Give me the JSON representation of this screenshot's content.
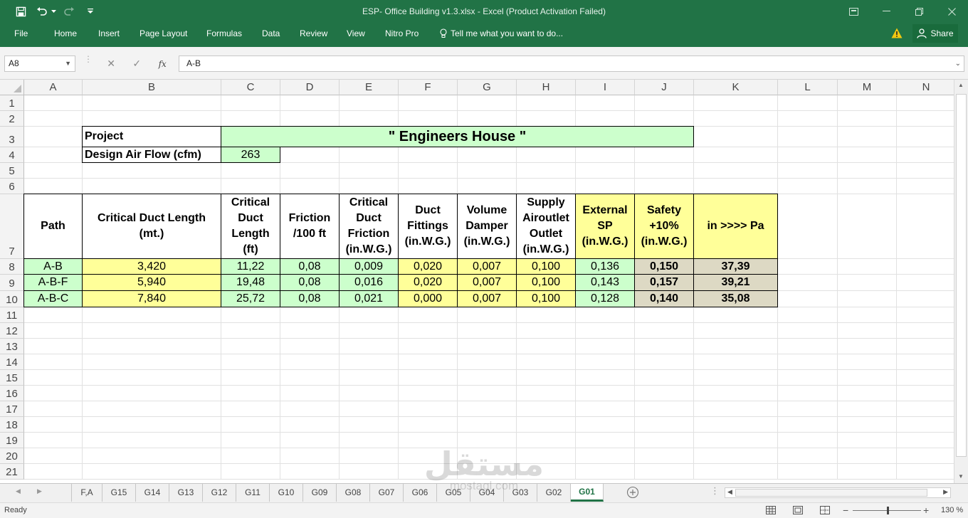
{
  "window": {
    "title": "ESP- Office Building v1.3.xlsx - Excel (Product Activation Failed)"
  },
  "ribbon": {
    "tabs": [
      "File",
      "Home",
      "Insert",
      "Page Layout",
      "Formulas",
      "Data",
      "Review",
      "View",
      "Nitro Pro"
    ],
    "tell_me": "Tell me what you want to do...",
    "share": "Share"
  },
  "formula_bar": {
    "name_box": "A8",
    "content": "A-B"
  },
  "columns": [
    "A",
    "B",
    "C",
    "D",
    "E",
    "F",
    "G",
    "H",
    "I",
    "J",
    "K",
    "L",
    "M",
    "N"
  ],
  "rows": [
    "1",
    "2",
    "3",
    "4",
    "5",
    "6",
    "7",
    "8",
    "9",
    "10",
    "11",
    "12",
    "13",
    "14",
    "15",
    "16",
    "17",
    "18",
    "19",
    "20",
    "21"
  ],
  "sheet": {
    "project_label": "Project",
    "project_name": "\" Engineers House \"",
    "airflow_label": "Design Air Flow (cfm)",
    "airflow_value": "263",
    "headers": [
      [
        "Path"
      ],
      [
        "Critical Duct Length",
        "(mt.)"
      ],
      [
        "Critical",
        "Duct",
        "Length",
        "(ft)"
      ],
      [
        "Friction",
        "/100 ft"
      ],
      [
        "Critical",
        "Duct",
        "Friction",
        "(in.W.G.)"
      ],
      [
        "Duct",
        "Fittings",
        "(in.W.G.)"
      ],
      [
        "Volume",
        "Damper",
        "(in.W.G.)"
      ],
      [
        "Supply",
        "Airoutlet",
        "Outlet",
        "(in.W.G.)"
      ],
      [
        "External",
        "SP",
        "(in.W.G.)"
      ],
      [
        "Safety",
        "+10%",
        "(in.W.G.)"
      ],
      [
        "in >>>> Pa"
      ]
    ],
    "data": [
      [
        "A-B",
        "3,420",
        "11,22",
        "0,08",
        "0,009",
        "0,020",
        "0,007",
        "0,100",
        "0,136",
        "0,150",
        "37,39"
      ],
      [
        "A-B-F",
        "5,940",
        "19,48",
        "0,08",
        "0,016",
        "0,020",
        "0,007",
        "0,100",
        "0,143",
        "0,157",
        "39,21"
      ],
      [
        "A-B-C",
        "7,840",
        "25,72",
        "0,08",
        "0,021",
        "0,000",
        "0,007",
        "0,100",
        "0,128",
        "0,140",
        "35,08"
      ]
    ]
  },
  "sheet_tabs": [
    "F,A",
    "G15",
    "G14",
    "G13",
    "G12",
    "G11",
    "G10",
    "G09",
    "G08",
    "G07",
    "G06",
    "G05",
    "G04",
    "G03",
    "G02",
    "G01"
  ],
  "active_sheet": "G01",
  "status": {
    "ready": "Ready",
    "zoom": "130 %"
  },
  "watermark": {
    "arabic": "مستقل",
    "latin": "mostaql.com"
  }
}
